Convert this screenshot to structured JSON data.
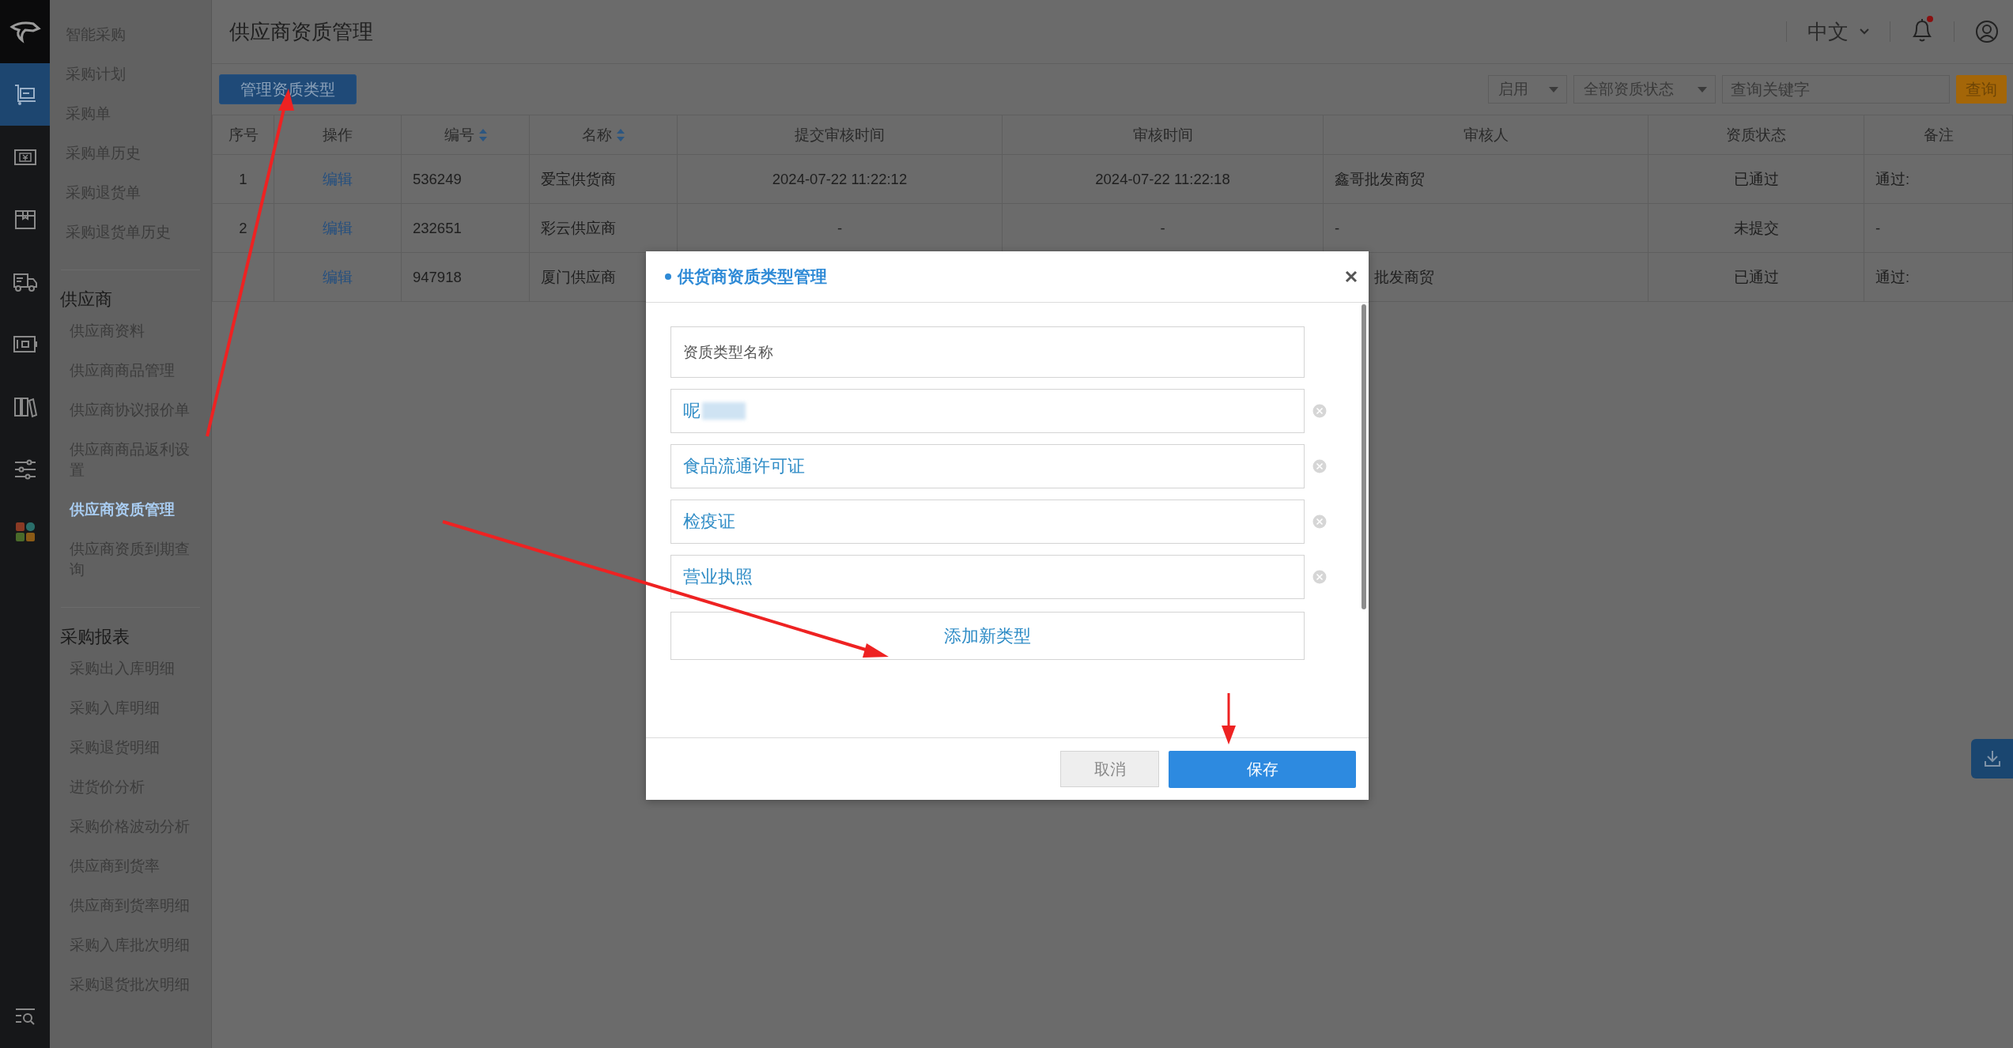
{
  "rail": {
    "items": [
      {
        "kind": "logo",
        "selected": false
      },
      {
        "kind": "cart",
        "selected": true
      },
      {
        "kind": "money",
        "selected": false
      },
      {
        "kind": "box",
        "selected": false
      },
      {
        "kind": "truck",
        "selected": false
      },
      {
        "kind": "safe",
        "selected": false
      },
      {
        "kind": "books",
        "selected": false
      },
      {
        "kind": "sliders",
        "selected": false
      },
      {
        "kind": "apps",
        "selected": false
      }
    ],
    "footer_icon": {
      "kind": "search-list"
    }
  },
  "sidebar": {
    "sections": [
      {
        "items": [
          {
            "label": "智能采购",
            "selected": false
          },
          {
            "label": "采购计划",
            "selected": false
          },
          {
            "label": "采购单",
            "selected": false
          },
          {
            "label": "采购单历史",
            "selected": false
          },
          {
            "label": "采购退货单",
            "selected": false
          },
          {
            "label": "采购退货单历史",
            "selected": false
          }
        ]
      },
      {
        "heading": "供应商",
        "items": [
          {
            "label": "供应商资料",
            "selected": false
          },
          {
            "label": "供应商商品管理",
            "selected": false
          },
          {
            "label": "供应商协议报价单",
            "selected": false
          },
          {
            "label": "供应商商品返利设置",
            "selected": false
          },
          {
            "label": "供应商资质管理",
            "selected": true
          },
          {
            "label": "供应商资质到期查询",
            "selected": false
          }
        ]
      },
      {
        "heading": "采购报表",
        "items": [
          {
            "label": "采购出入库明细",
            "selected": false
          },
          {
            "label": "采购入库明细",
            "selected": false
          },
          {
            "label": "采购退货明细",
            "selected": false
          },
          {
            "label": "进货价分析",
            "selected": false
          },
          {
            "label": "采购价格波动分析",
            "selected": false
          },
          {
            "label": "供应商到货率",
            "selected": false
          },
          {
            "label": "供应商到货率明细",
            "selected": false
          },
          {
            "label": "采购入库批次明细",
            "selected": false
          },
          {
            "label": "采购退货批次明细",
            "selected": false
          }
        ]
      }
    ]
  },
  "header": {
    "title": "供应商资质管理",
    "language": "中文",
    "has_unread": true
  },
  "toolbar": {
    "manage_button": "管理资质类型",
    "filters": [
      {
        "value": "启用"
      },
      {
        "value": "全部资质状态"
      }
    ],
    "search": {
      "placeholder": "查询关键字"
    },
    "query_button": "查询"
  },
  "table": {
    "columns": [
      {
        "label": "序号",
        "kind": "index",
        "sortable": false
      },
      {
        "label": "操作",
        "kind": "action",
        "sortable": false
      },
      {
        "label": "编号",
        "kind": "text",
        "sortable": true
      },
      {
        "label": "名称",
        "kind": "text",
        "sortable": true
      },
      {
        "label": "提交审核时间",
        "kind": "datetime",
        "sortable": false
      },
      {
        "label": "审核时间",
        "kind": "datetime",
        "sortable": false
      },
      {
        "label": "审核人",
        "kind": "text",
        "sortable": false
      },
      {
        "label": "资质状态",
        "kind": "status",
        "sortable": false
      },
      {
        "label": "备注",
        "kind": "text",
        "sortable": false
      }
    ],
    "rows": [
      [
        "1",
        "编辑",
        "536249",
        "爱宝供货商",
        "2024-07-22 11:22:12",
        "2024-07-22 11:22:18",
        "鑫哥批发商贸",
        "已通过",
        "通过:"
      ],
      [
        "2",
        "编辑",
        "232651",
        "彩云供应商",
        "-",
        "-",
        "-",
        "未提交",
        "-"
      ],
      [
        "",
        "编辑",
        "947918",
        "厦门供应商",
        "",
        "",
        {
          "text": "批发商贸",
          "covered": true
        },
        "已通过",
        "通过:"
      ]
    ]
  },
  "modal": {
    "title": "供货商资质类型管理",
    "fields": [
      {
        "kind": "new",
        "placeholder": "资质类型名称"
      },
      {
        "kind": "entry",
        "value": "呢",
        "redacted": true
      },
      {
        "kind": "entry",
        "value": "食品流通许可证",
        "redacted": false
      },
      {
        "kind": "entry",
        "value": "检疫证",
        "redacted": false
      },
      {
        "kind": "entry",
        "value": "营业执照",
        "redacted": false
      }
    ],
    "add_button": "添加新类型",
    "cancel_button": "取消",
    "save_button": "保存"
  }
}
